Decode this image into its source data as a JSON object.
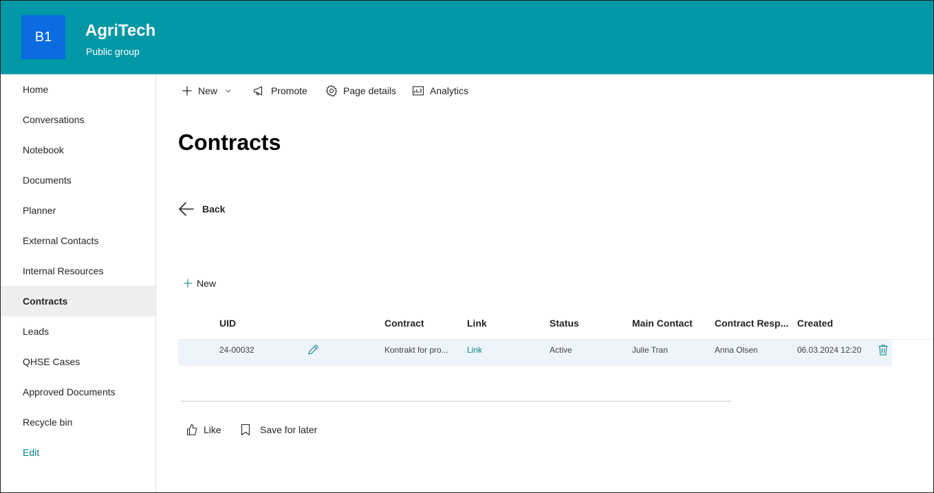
{
  "site": {
    "logo_text": "B1",
    "title": "AgriTech",
    "subtitle": "Public group",
    "header_color": "#0097a7",
    "logo_color": "#0b6be0"
  },
  "nav": {
    "items": [
      {
        "label": "Home"
      },
      {
        "label": "Conversations"
      },
      {
        "label": "Notebook"
      },
      {
        "label": "Documents"
      },
      {
        "label": "Planner"
      },
      {
        "label": "External Contacts"
      },
      {
        "label": "Internal Resources"
      },
      {
        "label": "Contracts",
        "active": true
      },
      {
        "label": "Leads"
      },
      {
        "label": "QHSE Cases"
      },
      {
        "label": "Approved Documents"
      },
      {
        "label": "Recycle bin"
      }
    ],
    "edit_label": "Edit"
  },
  "commandbar": {
    "new_label": "New",
    "promote_label": "Promote",
    "page_details_label": "Page details",
    "analytics_label": "Analytics"
  },
  "page": {
    "title": "Contracts",
    "back_label": "Back"
  },
  "list": {
    "new_label": "New",
    "columns": {
      "uid": "UID",
      "contract": "Contract",
      "link": "Link",
      "status": "Status",
      "main_contact": "Main Contact",
      "contract_resp": "Contract Resp...",
      "created": "Created"
    },
    "rows": [
      {
        "uid": "24-00032",
        "contract": "Kontrakt for pro...",
        "link": "Link",
        "status": "Active",
        "main_contact": "Julie Tran",
        "contract_resp": "Anna Olsen",
        "created": "06.03.2024 12:20"
      }
    ]
  },
  "footer": {
    "like_label": "Like",
    "save_label": "Save for later"
  },
  "icons": {
    "accent": "#038387"
  }
}
